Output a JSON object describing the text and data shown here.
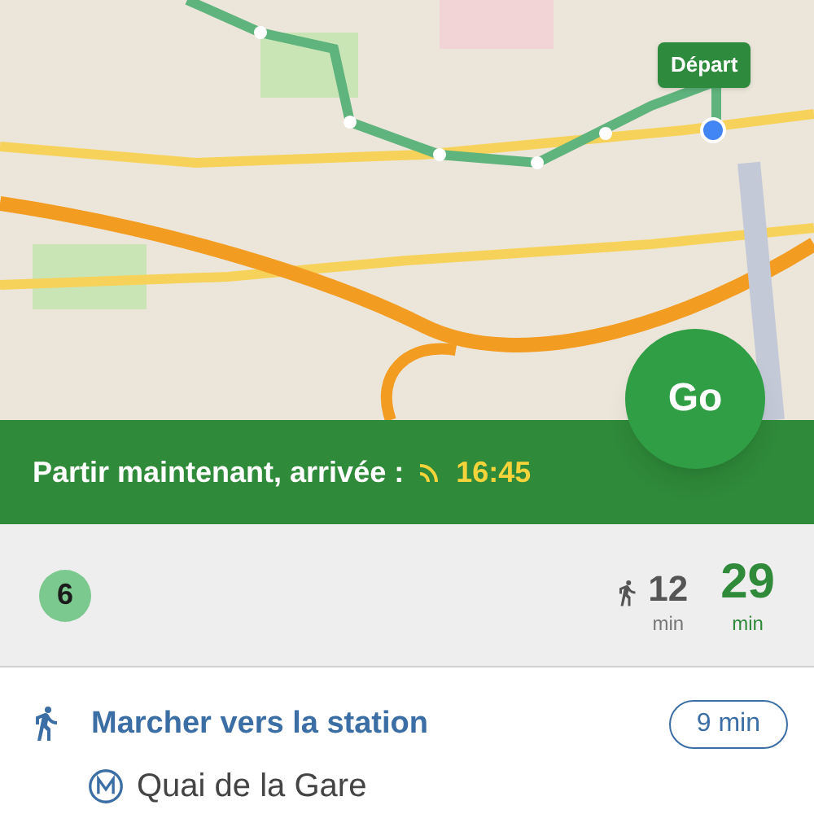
{
  "map": {
    "start_label": "Départ"
  },
  "go_button": "Go",
  "departure_bar": {
    "text": "Partir maintenant, arrivée :",
    "arrival_time": "16:45"
  },
  "summary": {
    "line_badge": "6",
    "walk_minutes": "12",
    "walk_unit": "min",
    "total_minutes": "29",
    "total_unit": "min"
  },
  "steps": [
    {
      "title": "Marcher vers la station",
      "duration": "9 min",
      "station": "Quai de la Gare"
    }
  ]
}
